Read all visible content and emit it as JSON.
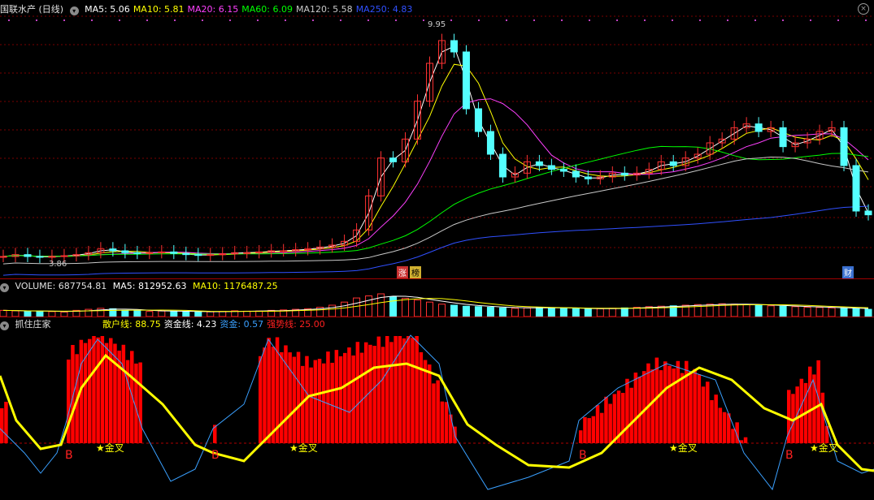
{
  "main_header": {
    "title": "国联水产 (日线)",
    "ma_items": [
      {
        "label": "MA5: 5.06",
        "color": "#ffffff"
      },
      {
        "label": "MA10: 5.81",
        "color": "#ffff00"
      },
      {
        "label": "MA20: 6.15",
        "color": "#ff40ff"
      },
      {
        "label": "MA60: 6.09",
        "color": "#00ff00"
      },
      {
        "label": "MA120: 5.58",
        "color": "#c8c8c8"
      },
      {
        "label": "MA250: 4.83",
        "color": "#3050ff"
      }
    ],
    "close_icon": "close-icon"
  },
  "price_labels": {
    "high": "9.95",
    "low": "3.86"
  },
  "event_tags": {
    "zhang": "涨",
    "bang": "榜",
    "cai": "财"
  },
  "volume_header": {
    "label": "VOLUME: 687754.81",
    "ma5": "MA5: 812952.63",
    "ma10": "MA10: 1176487.25"
  },
  "indicator_header": {
    "name": "抓住庄家",
    "items": [
      {
        "label": "散户线: 88.75",
        "color": "#ffff00"
      },
      {
        "label": "资金线: 4.23",
        "color": "#ffffff"
      },
      {
        "label": "资金: 0.57",
        "color": "#3aa0ff"
      },
      {
        "label": "强势线: 25.00",
        "color": "#ff2020"
      }
    ]
  },
  "signals": {
    "buy": "B",
    "golden_cross": "★金叉"
  },
  "colors": {
    "up": "#ff3232",
    "down": "#54ffff",
    "bar": "#ff0000",
    "retail_line": "#ffff00",
    "fund_line": "#3aa0ff"
  },
  "chart_data": {
    "type": "candlestick",
    "y_range_price": [
      3.86,
      9.95
    ],
    "price_series": [
      3.9,
      3.95,
      3.9,
      3.88,
      3.9,
      3.92,
      3.95,
      4.0,
      4.1,
      4.05,
      4.0,
      3.98,
      4.0,
      4.02,
      3.98,
      3.95,
      3.93,
      3.95,
      3.97,
      4.0,
      4.0,
      4.02,
      4.05,
      4.05,
      4.08,
      4.1,
      4.15,
      4.2,
      4.3,
      4.6,
      5.5,
      6.5,
      6.4,
      7.0,
      8.0,
      9.0,
      9.6,
      9.3,
      7.8,
      7.2,
      6.6,
      6.0,
      6.1,
      6.4,
      6.3,
      6.2,
      6.15,
      6.0,
      5.95,
      6.0,
      6.1,
      6.05,
      6.1,
      6.2,
      6.4,
      6.3,
      6.5,
      6.6,
      6.9,
      7.0,
      7.3,
      7.4,
      7.2,
      7.3,
      6.8,
      6.9,
      7.0,
      7.2,
      7.3,
      6.3,
      5.1,
      5.0
    ],
    "volume_series": [
      30,
      28,
      25,
      26,
      24,
      22,
      30,
      35,
      40,
      38,
      30,
      28,
      25,
      27,
      26,
      24,
      22,
      23,
      25,
      28,
      26,
      27,
      30,
      32,
      35,
      38,
      45,
      55,
      70,
      90,
      100,
      110,
      95,
      88,
      80,
      70,
      60,
      55,
      50,
      48,
      45,
      42,
      40,
      42,
      45,
      43,
      40,
      38,
      36,
      38,
      40,
      42,
      45,
      48,
      50,
      52,
      55,
      58,
      60,
      62,
      60,
      58,
      55,
      52,
      50,
      48,
      45,
      44,
      42,
      40,
      38,
      35
    ],
    "indicator": {
      "retail_line_last": 88.75,
      "fund_line_last": 4.23,
      "fund_last": 0.57,
      "strong_line": 25.0
    }
  }
}
